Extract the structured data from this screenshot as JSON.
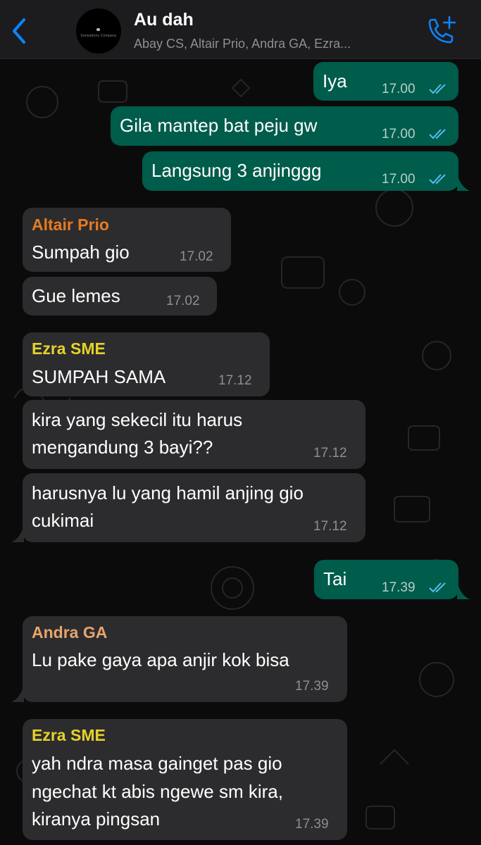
{
  "header": {
    "back_icon": "chevron-left-icon",
    "avatar_text": "Sensations Company",
    "title": "Au dah",
    "members": "Abay CS, Altair Prio, Andra GA, Ezra...",
    "call_icon": "add-call-icon",
    "accent_color": "#0a84ff"
  },
  "colors": {
    "outgoing_bubble": "#005c4b",
    "incoming_bubble": "#2c2c2e",
    "read_ticks": "#53bdeb",
    "sender_altair": "#e87a22",
    "sender_ezra": "#e5d22b",
    "sender_andra": "#e8a56b"
  },
  "messages": [
    {
      "type": "outgoing",
      "text": "Iya",
      "time": "17.00",
      "status": "read"
    },
    {
      "type": "outgoing",
      "text": "Gila mantep bat peju gw",
      "time": "17.00",
      "status": "read"
    },
    {
      "type": "outgoing",
      "text": "Langsung 3 anjinggg",
      "time": "17.00",
      "status": "read"
    },
    {
      "type": "incoming",
      "sender": "Altair Prio",
      "text": "Sumpah gio",
      "time": "17.02"
    },
    {
      "type": "incoming",
      "text": "Gue lemes",
      "time": "17.02"
    },
    {
      "type": "incoming",
      "sender": "Ezra SME",
      "text": "SUMPAH SAMA",
      "time": "17.12"
    },
    {
      "type": "incoming",
      "lines": [
        "kira yang sekecil itu harus",
        "mengandung 3 bayi??"
      ],
      "time": "17.12"
    },
    {
      "type": "incoming",
      "lines": [
        "harusnya lu yang hamil anjing gio",
        "cukimai"
      ],
      "time": "17.12"
    },
    {
      "type": "outgoing",
      "text": "Tai",
      "time": "17.39",
      "status": "read"
    },
    {
      "type": "incoming",
      "sender": "Andra GA",
      "text": "Lu pake gaya apa anjir kok bisa",
      "time": "17.39"
    },
    {
      "type": "incoming",
      "sender": "Ezra SME",
      "lines": [
        "yah ndra masa gainget pas gio",
        "ngechat kt abis ngewe sm kira,",
        "kiranya pingsan"
      ],
      "time": "17.39"
    }
  ]
}
